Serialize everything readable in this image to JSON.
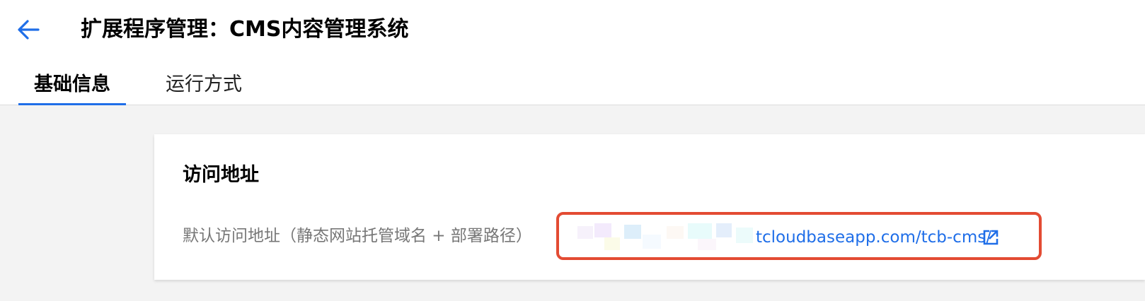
{
  "header": {
    "title": "扩展程序管理：CMS内容管理系统",
    "back_icon": "arrow-left-icon",
    "accent_color": "#1f6ee8"
  },
  "tabs": [
    {
      "label": "基础信息",
      "active": true
    },
    {
      "label": "运行方式",
      "active": false
    }
  ],
  "card": {
    "title": "访问地址",
    "field_label": "默认访问地址（静态网站托管域名 + 部署路径）",
    "url_text": "tcloudbaseapp.com/tcb-cms/",
    "external_icon": "external-link-icon",
    "highlight_color": "#e34b33"
  }
}
